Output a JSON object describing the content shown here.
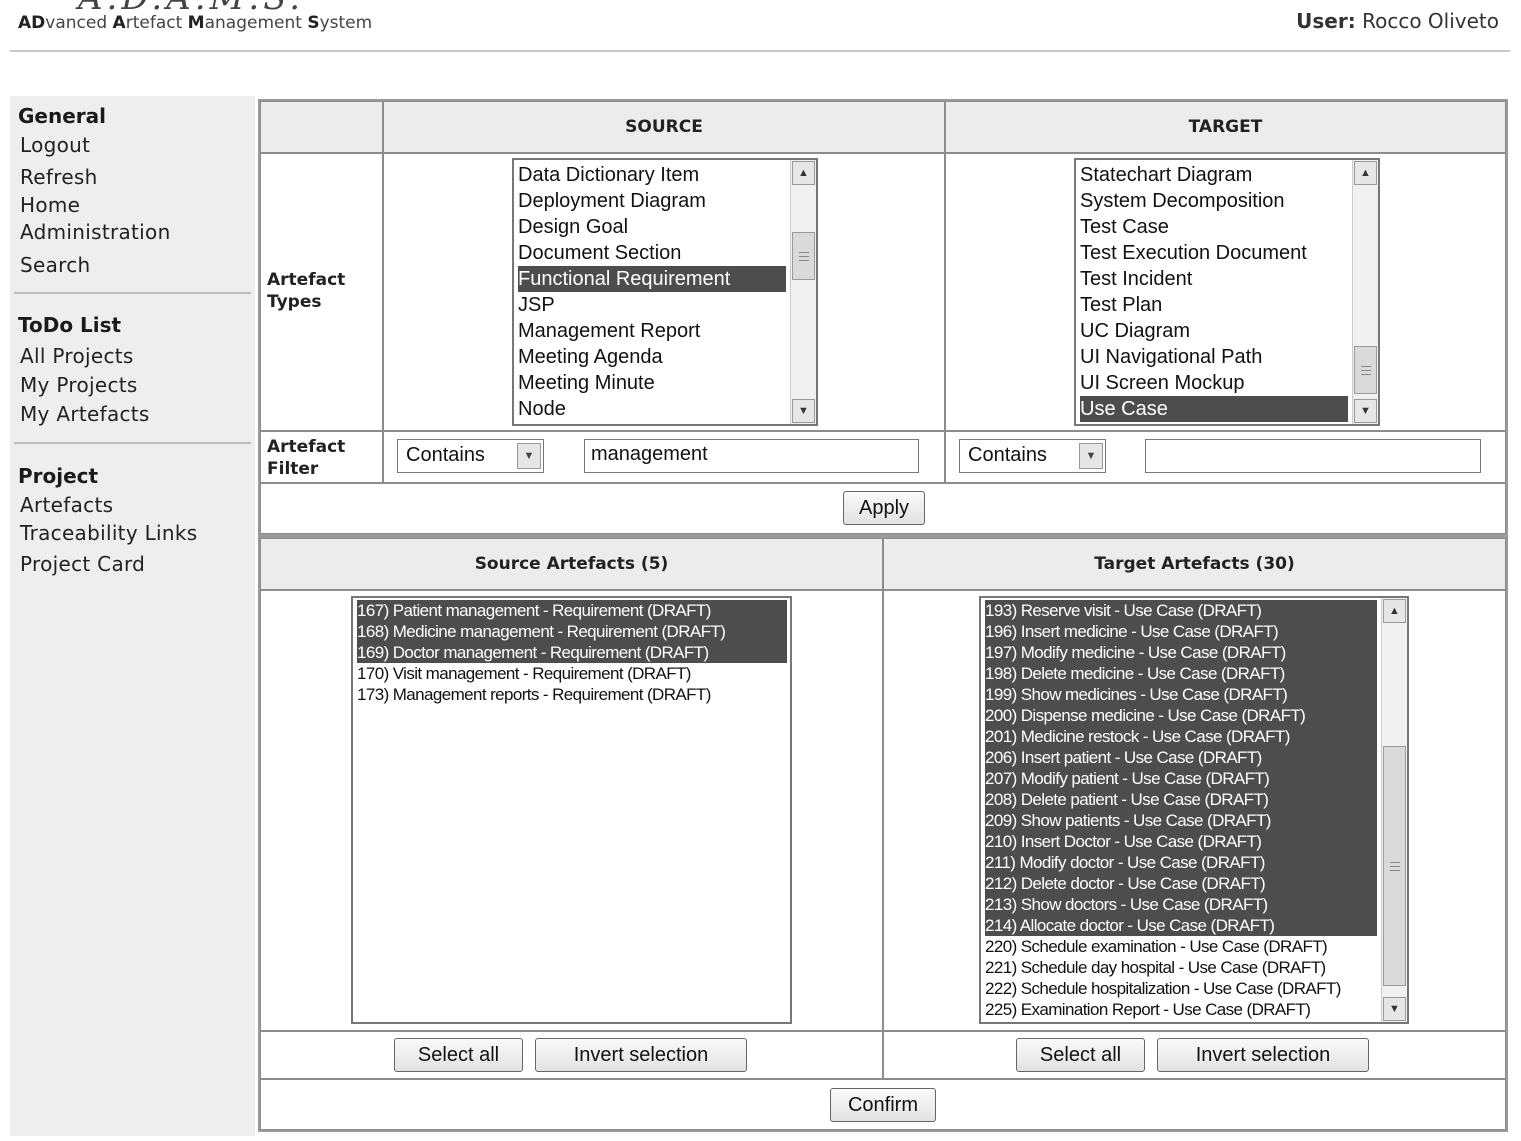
{
  "header": {
    "logo_fragment": "A.D.A.M.S.",
    "subtitle_parts": [
      "AD",
      "vanced ",
      "A",
      "rtefact ",
      "M",
      "anagement ",
      "S",
      "ystem"
    ],
    "user_label": "User:",
    "user_name": "Rocco Oliveto"
  },
  "sidebar": {
    "general": {
      "title": "General",
      "items": [
        "Logout",
        "Refresh",
        "Home",
        "Administration",
        "Search"
      ]
    },
    "todo": {
      "title": "ToDo List",
      "items": [
        "All Projects",
        "My Projects",
        "My Artefacts"
      ]
    },
    "project": {
      "title": "Project",
      "items": [
        "Artefacts",
        "Traceability Links",
        "Project Card"
      ]
    }
  },
  "filters": {
    "source_header": "SOURCE",
    "target_header": "TARGET",
    "types_label_1": "Artefact",
    "types_label_2": "Types",
    "filter_label_1": "Artefact",
    "filter_label_2": "Filter",
    "source_types": [
      {
        "label": "Data Dictionary Item",
        "selected": false
      },
      {
        "label": "Deployment Diagram",
        "selected": false
      },
      {
        "label": "Design Goal",
        "selected": false
      },
      {
        "label": "Document Section",
        "selected": false
      },
      {
        "label": "Functional Requirement",
        "selected": true
      },
      {
        "label": "JSP",
        "selected": false
      },
      {
        "label": "Management Report",
        "selected": false
      },
      {
        "label": "Meeting Agenda",
        "selected": false
      },
      {
        "label": "Meeting Minute",
        "selected": false
      },
      {
        "label": "Node",
        "selected": false
      }
    ],
    "target_types": [
      {
        "label": "Statechart Diagram",
        "selected": false
      },
      {
        "label": "System Decomposition",
        "selected": false
      },
      {
        "label": "Test Case",
        "selected": false
      },
      {
        "label": "Test Execution Document",
        "selected": false
      },
      {
        "label": "Test Incident",
        "selected": false
      },
      {
        "label": "Test Plan",
        "selected": false
      },
      {
        "label": "UC Diagram",
        "selected": false
      },
      {
        "label": "UI Navigational Path",
        "selected": false
      },
      {
        "label": "UI Screen Mockup",
        "selected": false
      },
      {
        "label": "Use Case",
        "selected": true
      }
    ],
    "source_operator": "Contains",
    "source_filter_value": "management",
    "target_operator": "Contains",
    "target_filter_value": "",
    "apply_label": "Apply"
  },
  "artefacts": {
    "source_header": "Source Artefacts (5)",
    "target_header": "Target Artefacts (30)",
    "source_items": [
      {
        "label": "167) Patient management - Requirement (DRAFT)",
        "selected": true
      },
      {
        "label": "168) Medicine management - Requirement (DRAFT)",
        "selected": true
      },
      {
        "label": "169) Doctor management - Requirement (DRAFT)",
        "selected": true
      },
      {
        "label": "170) Visit management - Requirement (DRAFT)",
        "selected": false
      },
      {
        "label": "173) Management reports - Requirement (DRAFT)",
        "selected": false
      }
    ],
    "target_items": [
      {
        "label": "193) Reserve visit - Use Case (DRAFT)",
        "selected": true
      },
      {
        "label": "196) Insert medicine - Use Case (DRAFT)",
        "selected": true
      },
      {
        "label": "197) Modify medicine - Use Case (DRAFT)",
        "selected": true
      },
      {
        "label": "198) Delete medicine - Use Case (DRAFT)",
        "selected": true
      },
      {
        "label": "199) Show medicines - Use Case (DRAFT)",
        "selected": true
      },
      {
        "label": "200) Dispense medicine - Use Case (DRAFT)",
        "selected": true
      },
      {
        "label": "201) Medicine restock - Use Case (DRAFT)",
        "selected": true
      },
      {
        "label": "206) Insert patient - Use Case (DRAFT)",
        "selected": true
      },
      {
        "label": "207) Modify patient - Use Case (DRAFT)",
        "selected": true
      },
      {
        "label": "208) Delete patient - Use Case (DRAFT)",
        "selected": true
      },
      {
        "label": "209) Show patients - Use Case (DRAFT)",
        "selected": true
      },
      {
        "label": "210) Insert Doctor - Use Case (DRAFT)",
        "selected": true
      },
      {
        "label": "211) Modify doctor - Use Case (DRAFT)",
        "selected": true
      },
      {
        "label": "212) Delete doctor - Use Case (DRAFT)",
        "selected": true
      },
      {
        "label": "213) Show doctors - Use Case (DRAFT)",
        "selected": true
      },
      {
        "label": "214) Allocate doctor - Use Case (DRAFT)",
        "selected": true
      },
      {
        "label": "220) Schedule examination - Use Case (DRAFT)",
        "selected": false
      },
      {
        "label": "221) Schedule day hospital - Use Case (DRAFT)",
        "selected": false
      },
      {
        "label": "222) Schedule hospitalization - Use Case (DRAFT)",
        "selected": false
      },
      {
        "label": "225) Examination Report - Use Case (DRAFT)",
        "selected": false
      }
    ],
    "select_all_label": "Select all",
    "invert_label": "Invert selection",
    "confirm_label": "Confirm"
  }
}
